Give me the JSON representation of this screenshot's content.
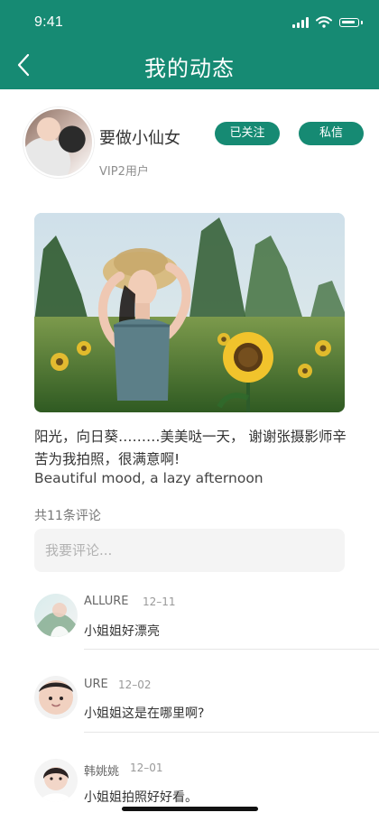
{
  "status": {
    "time": "9:41"
  },
  "header": {
    "title": "我的动态",
    "back_icon": "chevron-left-icon"
  },
  "profile": {
    "name": "要做小仙女",
    "level": "VIP2用户",
    "follow_label": "已关注",
    "message_label": "私信"
  },
  "post": {
    "text_cn": "阳光，向日葵………美美哒一天， 谢谢张摄影师辛苦为我拍照，很满意啊!",
    "text_en": "Beautiful mood, a lazy afternoon"
  },
  "comments_section": {
    "count_label": "共11条评论",
    "input_placeholder": "我要评论..."
  },
  "comments": [
    {
      "name": "ALLURE",
      "date": "12–11",
      "text": "小姐姐好漂亮"
    },
    {
      "name": "URE",
      "date": "12–02",
      "text": "小姐姐这是在哪里啊?"
    },
    {
      "name": "韩姚姚",
      "date": "12–01",
      "text": "小姐姐拍照好好看。"
    }
  ],
  "colors": {
    "accent": "#168a73",
    "input_bg": "#f4f4f4",
    "text_primary": "#333333",
    "text_secondary": "#8f8f8f"
  }
}
